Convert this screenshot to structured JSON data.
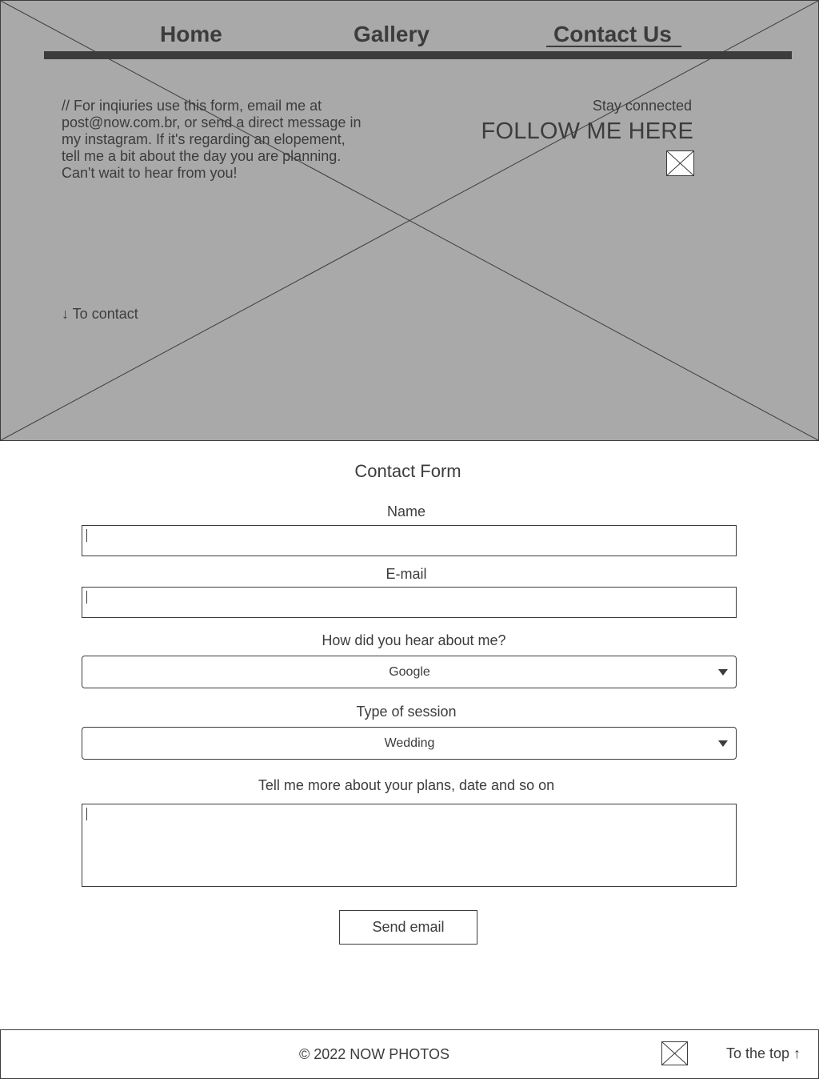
{
  "nav": {
    "home": "Home",
    "gallery": "Gallery",
    "contact": "Contact Us",
    "active": "contact"
  },
  "hero": {
    "intro": "// For inqiuries use this form, email me at post@now.com.br, or send a direct message in my instagram. If it's regarding an elopement, tell me a bit about the day you are planning. Can't wait to hear from you!",
    "stay_connected": "Stay connected",
    "follow": "FOLLOW ME HERE",
    "social_icon": "image-placeholder-icon",
    "to_contact": "↓ To contact"
  },
  "form": {
    "title": "Contact Form",
    "name_label": "Name",
    "name_value": "",
    "email_label": "E-mail",
    "email_value": "",
    "hear_label": "How did you hear about me?",
    "hear_value": "Google",
    "session_label": "Type of session",
    "session_value": "Wedding",
    "plans_label": "Tell me more about your plans, date and so on",
    "plans_value": "",
    "send_label": "Send email"
  },
  "footer": {
    "copyright": "© 2022 NOW PHOTOS",
    "icon": "image-placeholder-icon",
    "to_top": "To the top ↑"
  },
  "colors": {
    "hero_bg": "#a9a9a9",
    "ink": "#3c3c3c",
    "page_bg": "#ffffff"
  }
}
